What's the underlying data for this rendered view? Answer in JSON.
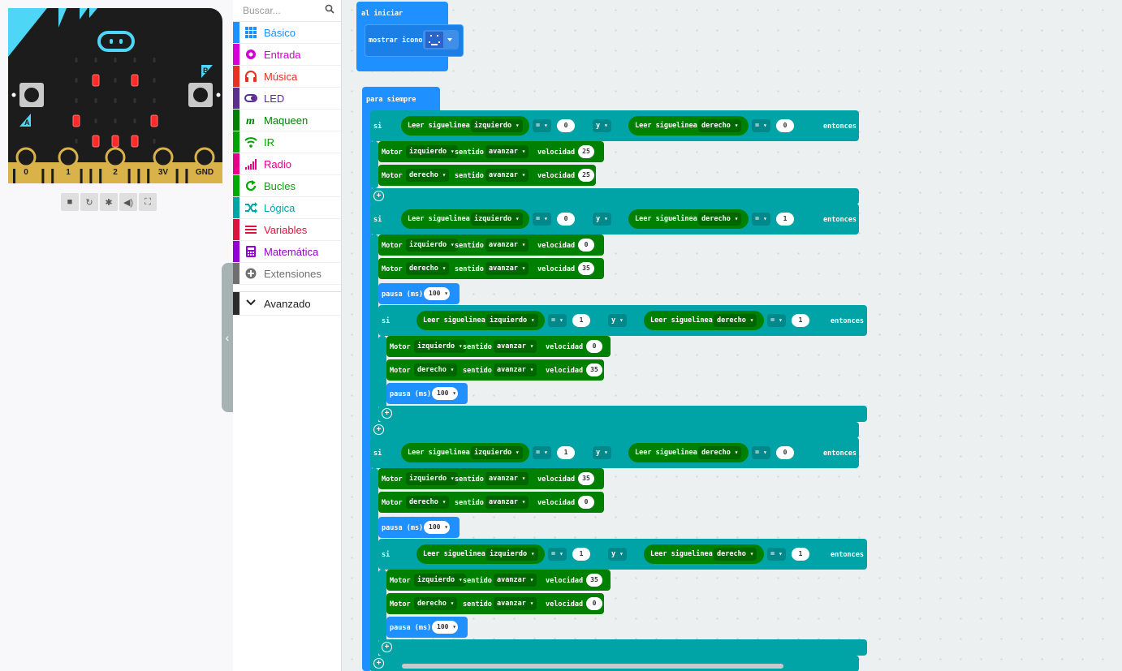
{
  "simulator": {
    "pins": [
      "0",
      "1",
      "2",
      "3V",
      "GND"
    ],
    "button_a": "A",
    "button_b": "B",
    "controls": [
      "stop-icon",
      "restart-icon",
      "debug-icon",
      "sound-icon",
      "fullscreen-icon"
    ]
  },
  "toolbox": {
    "search_placeholder": "Buscar...",
    "categories": [
      {
        "label": "Básico",
        "color": "#1e90ff",
        "icon": "grid-icon"
      },
      {
        "label": "Entrada",
        "color": "#d400d4",
        "icon": "target-icon"
      },
      {
        "label": "Música",
        "color": "#e63022",
        "icon": "headphones-icon"
      },
      {
        "label": "LED",
        "color": "#5c2d91",
        "icon": "toggle-icon"
      },
      {
        "label": "Maqueen",
        "color": "#008000",
        "icon": "m-icon"
      },
      {
        "label": "IR",
        "color": "#00a000",
        "icon": "wifi-icon"
      },
      {
        "label": "Radio",
        "color": "#e3008c",
        "icon": "signal-icon"
      },
      {
        "label": "Bucles",
        "color": "#00aa00",
        "icon": "loop-icon"
      },
      {
        "label": "Lógica",
        "color": "#00a4a6",
        "icon": "shuffle-icon"
      },
      {
        "label": "Variables",
        "color": "#dc143c",
        "icon": "lines-icon"
      },
      {
        "label": "Matemática",
        "color": "#9400d3",
        "icon": "calculator-icon"
      },
      {
        "label": "Extensiones",
        "color": "#707070",
        "icon": "plus-circle-icon"
      }
    ],
    "advanced": "Avanzado"
  },
  "colors": {
    "basic": "#1e90ff",
    "logic": "#00a4a6",
    "maqueen": "#008000",
    "logicDark": "#00888a",
    "maqueenDark": "#006600"
  },
  "workspace": {
    "on_start": {
      "label": "al iniciar",
      "show_icon": "mostrar icono"
    },
    "forever": {
      "label": "para siempre"
    },
    "kw": {
      "si": "si",
      "y": "y",
      "entonces": "entonces",
      "eq": "=",
      "motor": "Motor",
      "sentido": "sentido",
      "velocidad": "velocidad",
      "read": "Leer siguelinea",
      "pausa": "pausa (ms)",
      "izq": "izquierdo",
      "der": "derecho",
      "avanzar": "avanzar"
    },
    "ifs": [
      {
        "l": "0",
        "r": "0",
        "motors": [
          "25",
          "25"
        ],
        "pause": null,
        "nested": null
      },
      {
        "l": "0",
        "r": "1",
        "motors": [
          "0",
          "35"
        ],
        "pause": "100",
        "nested": {
          "l": "1",
          "r": "1",
          "motors": [
            "0",
            "35"
          ],
          "pause": "100"
        }
      },
      {
        "l": "1",
        "r": "0",
        "motors": [
          "35",
          "0"
        ],
        "pause": "100",
        "nested": {
          "l": "1",
          "r": "1",
          "motors": [
            "35",
            "0"
          ],
          "pause": "100"
        }
      }
    ]
  }
}
